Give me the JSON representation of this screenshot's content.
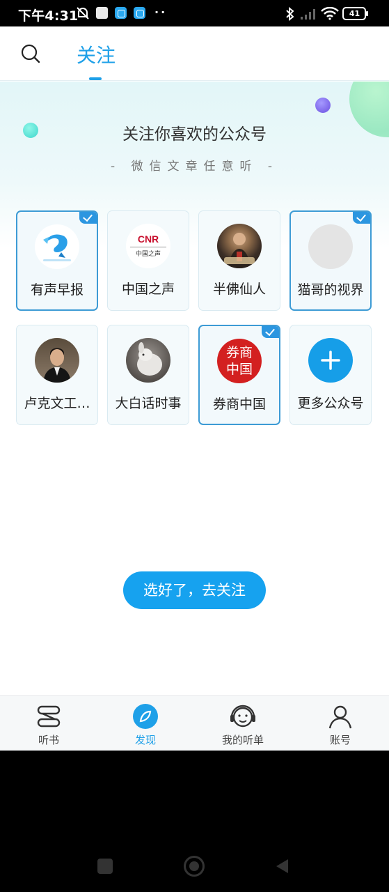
{
  "status_bar": {
    "time": "下午4:31",
    "battery": "41"
  },
  "header": {
    "tab_label": "关注"
  },
  "hero": {
    "title": "关注你喜欢的公众号",
    "subtitle": "- 微信文章任意听 -"
  },
  "accounts": [
    {
      "name": "有声早报",
      "selected": true,
      "icon": "dolphin-logo"
    },
    {
      "name": "中国之声",
      "selected": false,
      "icon": "cnr-logo",
      "logo_text": "CNR",
      "logo_subtext": "中国之声"
    },
    {
      "name": "半佛仙人",
      "selected": false,
      "icon": "person-photo"
    },
    {
      "name": "猫哥的视界",
      "selected": true,
      "icon": "placeholder-avatar"
    },
    {
      "name": "卢克文工…",
      "selected": false,
      "icon": "person-photo"
    },
    {
      "name": "大白话时事",
      "selected": false,
      "icon": "animal-photo"
    },
    {
      "name": "券商中国",
      "selected": true,
      "icon": "seal-logo",
      "logo_text": "券商中国"
    },
    {
      "name": "更多公众号",
      "selected": false,
      "icon": "plus-icon"
    }
  ],
  "cta_label": "选好了，去关注",
  "bottom_nav": [
    {
      "label": "听书",
      "active": false,
      "icon": "books-icon"
    },
    {
      "label": "发现",
      "active": true,
      "icon": "compass-icon"
    },
    {
      "label": "我的听单",
      "active": false,
      "icon": "headphones-face-icon"
    },
    {
      "label": "账号",
      "active": false,
      "icon": "user-icon"
    }
  ],
  "colors": {
    "accent": "#1ea0e8",
    "selected_border": "#3d9bd5"
  }
}
